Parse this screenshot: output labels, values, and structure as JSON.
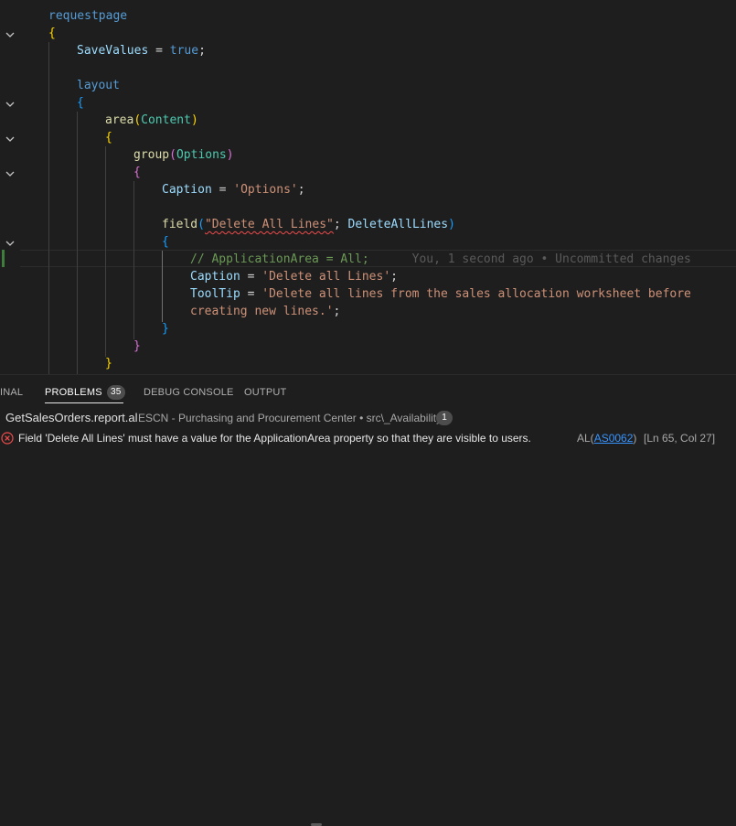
{
  "editor": {
    "code_lines": [
      {
        "tokens": [
          {
            "t": "requestpage",
            "c": "kw"
          }
        ]
      },
      {
        "tokens": [
          {
            "t": "{",
            "c": "b1"
          }
        ]
      },
      {
        "tokens": [
          {
            "t": "SaveValues",
            "c": "prop"
          },
          {
            "t": " = ",
            "c": ""
          },
          {
            "t": "true",
            "c": "kw"
          },
          {
            "t": ";",
            "c": ""
          }
        ]
      },
      {
        "tokens": []
      },
      {
        "tokens": [
          {
            "t": "layout",
            "c": "kw"
          }
        ]
      },
      {
        "tokens": [
          {
            "t": "{",
            "c": "b3"
          }
        ]
      },
      {
        "tokens": [
          {
            "t": "area",
            "c": "fn"
          },
          {
            "t": "(",
            "c": "b1"
          },
          {
            "t": "Content",
            "c": "cls"
          },
          {
            "t": ")",
            "c": "b1"
          }
        ]
      },
      {
        "tokens": [
          {
            "t": "{",
            "c": "b1"
          }
        ]
      },
      {
        "tokens": [
          {
            "t": "group",
            "c": "fn"
          },
          {
            "t": "(",
            "c": "b2"
          },
          {
            "t": "Options",
            "c": "cls"
          },
          {
            "t": ")",
            "c": "b2"
          }
        ]
      },
      {
        "tokens": [
          {
            "t": "{",
            "c": "b2"
          }
        ]
      },
      {
        "tokens": [
          {
            "t": "Caption",
            "c": "prop"
          },
          {
            "t": " = ",
            "c": ""
          },
          {
            "t": "'Options'",
            "c": "str"
          },
          {
            "t": ";",
            "c": ""
          }
        ]
      },
      {
        "tokens": []
      },
      {
        "tokens": [
          {
            "t": "field",
            "c": "fn"
          },
          {
            "t": "(",
            "c": "b3"
          },
          {
            "t": "\"Delete All Lines\"",
            "c": "str squig"
          },
          {
            "t": "; ",
            "c": ""
          },
          {
            "t": "DeleteAllLines",
            "c": "prop"
          },
          {
            "t": ")",
            "c": "b3"
          }
        ]
      },
      {
        "tokens": [
          {
            "t": "{",
            "c": "b3"
          }
        ]
      },
      {
        "tokens": [
          {
            "t": "// ApplicationArea = All;",
            "c": "cmt"
          },
          {
            "t": "      You, 1 second ago • Uncommitted changes",
            "c": "blame"
          }
        ]
      },
      {
        "tokens": [
          {
            "t": "Caption",
            "c": "prop"
          },
          {
            "t": " = ",
            "c": ""
          },
          {
            "t": "'Delete all Lines'",
            "c": "str"
          },
          {
            "t": ";",
            "c": ""
          }
        ]
      },
      {
        "tokens": [
          {
            "t": "ToolTip",
            "c": "prop"
          },
          {
            "t": " = ",
            "c": ""
          },
          {
            "t": "'Delete all lines from the sales allocation worksheet before",
            "c": "str"
          }
        ]
      },
      {
        "tokens": [
          {
            "t": "creating new lines.'",
            "c": "str"
          },
          {
            "t": ";",
            "c": ""
          }
        ]
      },
      {
        "tokens": [
          {
            "t": "}",
            "c": "b3"
          }
        ]
      },
      {
        "tokens": [
          {
            "t": "}",
            "c": "b2"
          }
        ]
      },
      {
        "tokens": [
          {
            "t": "}",
            "c": "b1"
          }
        ]
      }
    ],
    "fold_icon": "chevron-down-icon"
  },
  "panel": {
    "tabs": [
      {
        "label": "INAL",
        "active": false
      },
      {
        "label": "PROBLEMS",
        "active": true,
        "badge": "35"
      },
      {
        "label": "DEBUG CONSOLE",
        "active": false
      },
      {
        "label": "OUTPUT",
        "active": false
      }
    ],
    "file": {
      "name": "GetSalesOrders.report.al",
      "path": "ESCN - Purchasing and Procurement Center • src\\_Availability",
      "count": "1"
    },
    "problem": {
      "icon": "error-icon",
      "message": "Field 'Delete All Lines' must have a value for the ApplicationArea property so that they are visible to users.",
      "source_prefix": "AL(",
      "code": "AS0062",
      "source_suffix": ")",
      "location": "[Ln 65, Col 27]"
    },
    "colors": {
      "error": "#f14c4c",
      "link": "#3794ff",
      "badge_bg": "#4d4d4d"
    }
  }
}
